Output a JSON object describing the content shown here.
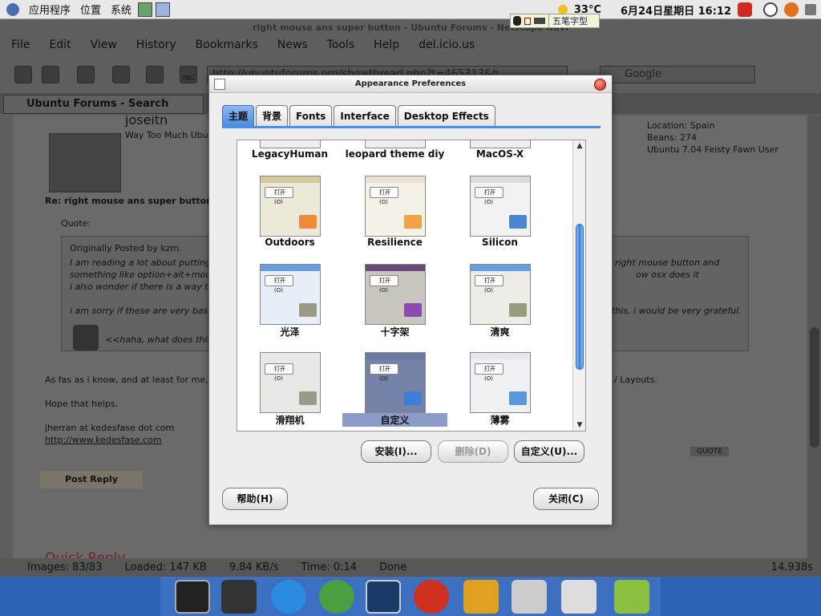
{
  "top_panel": {
    "menus": [
      "应用程序",
      "位置",
      "系统"
    ],
    "temperature": "33°C",
    "datetime": "6月24日星期日 16:12"
  },
  "ime": {
    "name": "五笔字型"
  },
  "browser": {
    "title": "right mouse ans super button - Ubuntu Forums - Netscape Navi",
    "menus": [
      "File",
      "Edit",
      "View",
      "History",
      "Bookmarks",
      "News",
      "Tools",
      "Help",
      "del.icio.us"
    ],
    "url": "http://ubuntuforums.org/showthread.php?t=465313&h",
    "search_placeholder": "Google",
    "tab_label": "Ubuntu Forums - Search Res...",
    "tag_label": "TAG",
    "page": {
      "username": "joseitn",
      "user_title": "Way Too Much Ubuntu",
      "location": "Location: Spain",
      "beans": "Beans: 274",
      "os": "Ubuntu 7.04 Feisty Fawn User",
      "reply_title": "Re: right mouse ans super button",
      "quote_label": "Quote:",
      "originally_posted": "Originally Posted by kzm.",
      "quote_line1": "I am reading a lot about putting yo",
      "quote_line1b": "right mouse button and",
      "quote_line2": "something like option+alt+mouse f",
      "quote_line2b": "ow osx does it",
      "quote_line3": "i also wonder if there is a way to m",
      "quote_line4": "i am sorry if these are very basic qu",
      "quote_line4b": "this, i would be very grateful.",
      "emote_text": "<<haha, what does this st",
      "answer": "As fas as i know, and at least for me, pickin",
      "answer_end": "/ Layouts.",
      "hope": "Hope that helps.",
      "sig1": "jherran at kedesfase dot com",
      "sig2": "http://www.kedesfase.com",
      "quote_btn": "QUOTE",
      "post_reply": "Post Reply",
      "quick_reply": "Quick Reply"
    },
    "status": {
      "images": "Images: 83/83",
      "loaded": "Loaded: 147 KB",
      "speed": "9.84 KB/s",
      "time": "Time: 0:14",
      "done": "Done",
      "elapsed": "14.938s"
    }
  },
  "dialog": {
    "title": "Appearance Preferences",
    "tabs": [
      {
        "label": "主题",
        "active": true
      },
      {
        "label": "背景",
        "active": false
      },
      {
        "label": "Fonts",
        "active": false
      },
      {
        "label": "Interface",
        "active": false
      },
      {
        "label": "Desktop Effects",
        "active": false
      }
    ],
    "themes": [
      {
        "name": "LegacyHuman"
      },
      {
        "name": "leopard theme diy"
      },
      {
        "name": "MacOS-X"
      },
      {
        "name": "Outdoors",
        "bar": "#d8c8a0",
        "bg": "#ece9d8",
        "folder": "#f08a3a"
      },
      {
        "name": "Resilience",
        "bar": "#e6e2d4",
        "bg": "#f4f1e7",
        "folder": "#f0a340"
      },
      {
        "name": "Silicon",
        "bar": "#dcdcdc",
        "bg": "#f2f2f2",
        "folder": "#4a86d0"
      },
      {
        "name": "光泽",
        "bar": "#6a9ce0",
        "bg": "#e8eef5",
        "folder": "#9a9a88"
      },
      {
        "name": "十字架",
        "bar": "#6a4a7a",
        "bg": "#c9c6bf",
        "folder": "#8a4ab0"
      },
      {
        "name": "清爽",
        "bar": "#6a9ce0",
        "bg": "#ecebe6",
        "folder": "#9a9a80"
      },
      {
        "name": "滑翔机",
        "bar": "#e8e8e8",
        "bg": "#e9e8e4",
        "folder": "#9a9a88"
      },
      {
        "name": "自定义",
        "bar": "#6a7aa0",
        "bg": "#7482a8",
        "folder": "#3f7ed8",
        "selected": true
      },
      {
        "name": "薄雾",
        "bar": "#e6e8ee",
        "bg": "#eef0f4",
        "folder": "#5a96dc"
      }
    ],
    "button_label": "打开(O)",
    "buttons": {
      "install": "安装(I)...",
      "delete": "删除(D)",
      "customize": "自定义(U)...",
      "help": "帮助(H)",
      "close": "关闭(C)"
    }
  },
  "colors": {
    "accent": "#4d8de0",
    "selection": "#8c9cc8",
    "dock": "#2d62b5"
  }
}
